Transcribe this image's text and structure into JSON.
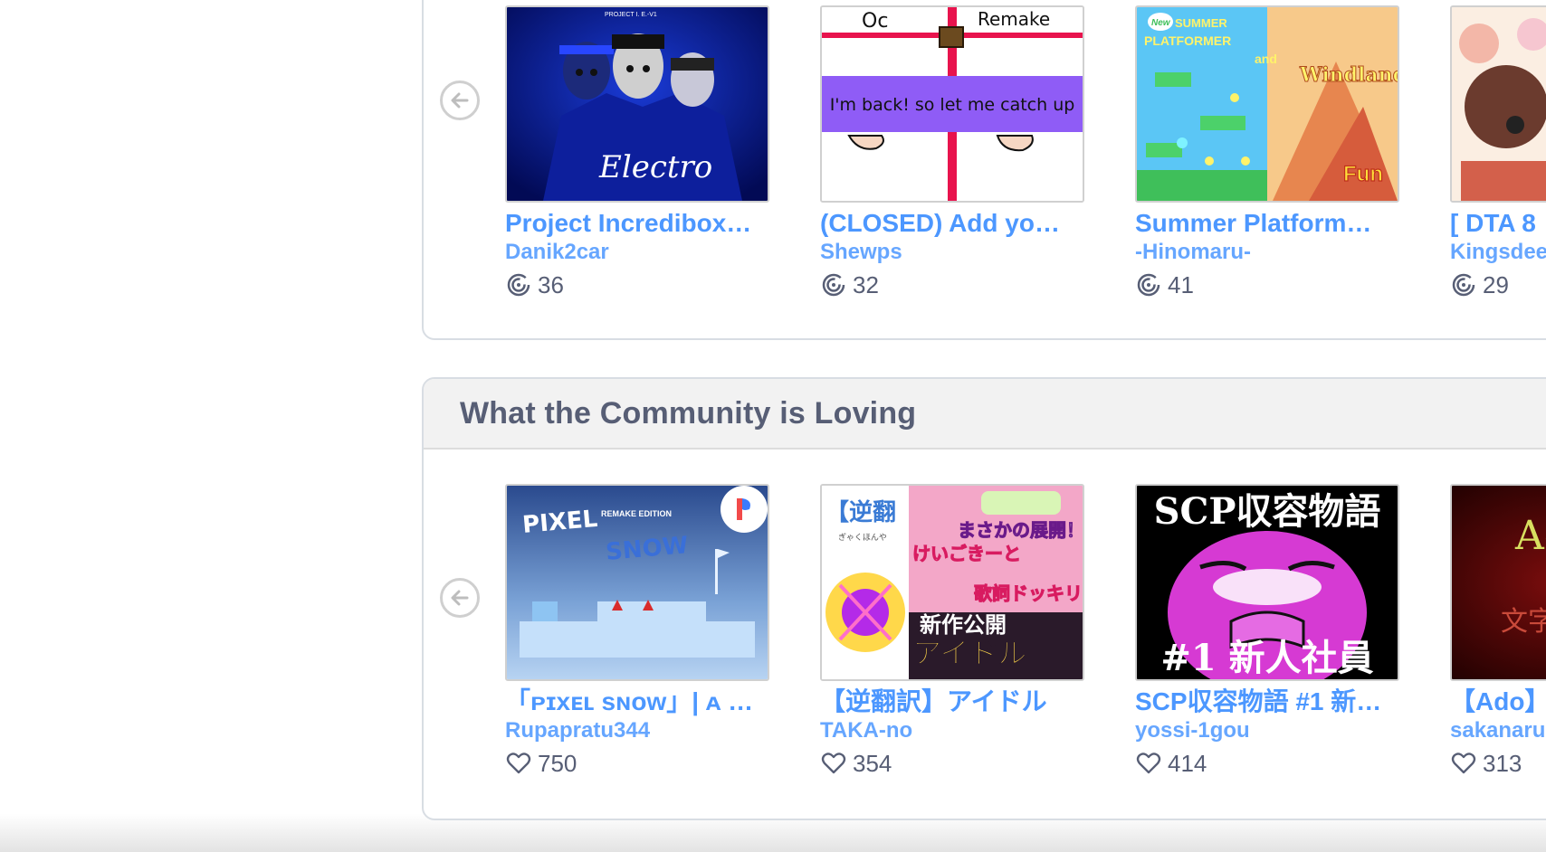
{
  "top_row": {
    "cards": [
      {
        "title": "Project Incredibox…",
        "author": "Danik2car",
        "remix_count": "36",
        "thumb_text": "Electro",
        "thumb_subtext": "PROJECT I. E.-V1"
      },
      {
        "title": "(CLOSED) Add yo…",
        "author": "Shewps",
        "remix_count": "32",
        "thumb_left": "Oc",
        "thumb_right": "Remake",
        "thumb_banner": "I'm back! so let me catch up"
      },
      {
        "title": "Summer Platform…",
        "author": "-Hinomaru-",
        "remix_count": "41",
        "thumb_badge": "New",
        "thumb_line1": "SUMMER",
        "thumb_line2": "PLATFORMER",
        "thumb_and": "and",
        "thumb_windland": "Windland",
        "thumb_fun": "Fun"
      },
      {
        "title": "[ DTA 8",
        "author": "Kingsdee",
        "remix_count": "29"
      }
    ],
    "stat_icon": "remix-icon"
  },
  "community": {
    "title": "What the Community is Loving",
    "cards": [
      {
        "title": "「ᴘɪxᴇʟ sɴᴏᴡ」| ᴀ …",
        "author": "Rupapratu344",
        "loves": "750",
        "thumb_pixel": "PIXEL",
        "thumb_snow": "SNOW",
        "thumb_edition": "REMAKE EDITION"
      },
      {
        "title": "【逆翻訳】アイドル",
        "author": "TAKA-no",
        "loves": "354",
        "thumb_bracket": "【逆翻",
        "thumb_kana": "ぎゃくほんや",
        "thumb_line1": "まさかの展開！？",
        "thumb_line2": "けいごきーと",
        "thumb_line3": "歌詞ドッキリ",
        "thumb_line4": "新作公開",
        "thumb_line5": "アイドル"
      },
      {
        "title": "SCP収容物語 #1 新…",
        "author": "yossi-1gou",
        "loves": "414",
        "thumb_top": "SCP収容物語",
        "thumb_bottom": "#1 新人社員"
      },
      {
        "title": "【Ado】",
        "author": "sakanaru",
        "loves": "313",
        "thumb_text": "Ad",
        "thumb_sub": "文字"
      }
    ],
    "stat_icon": "heart-icon"
  },
  "colors": {
    "link": "#4c97ff",
    "heading": "#575e75",
    "border": "#d8dde3"
  }
}
